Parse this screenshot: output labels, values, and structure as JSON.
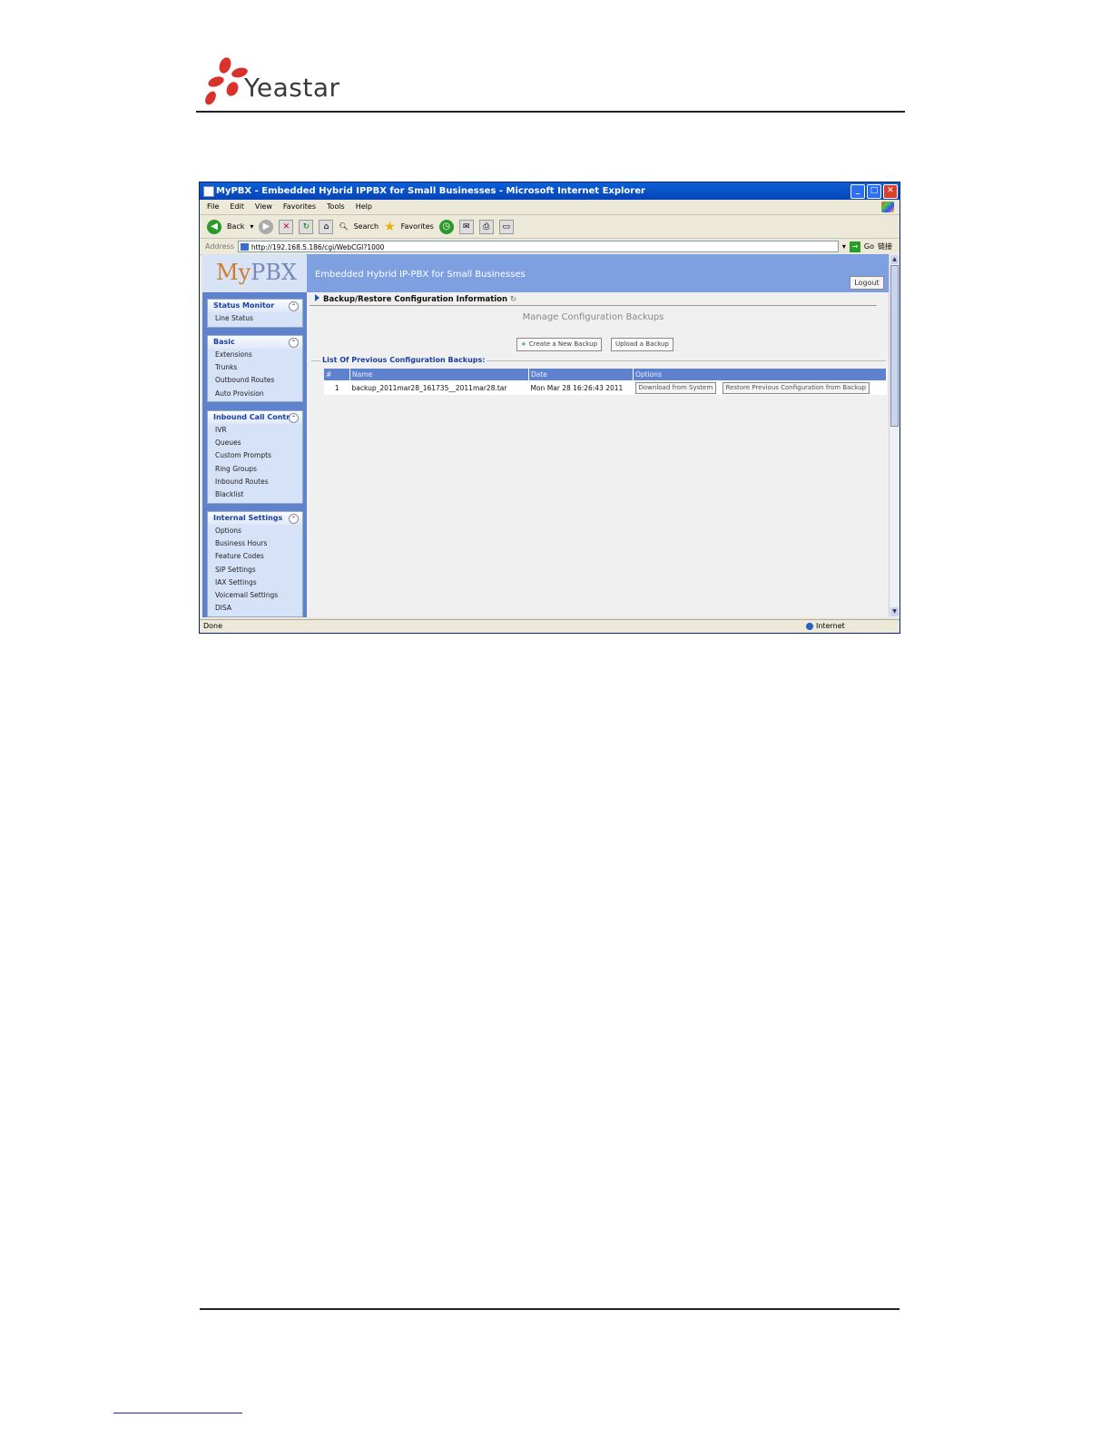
{
  "header": {
    "brand": "Yeastar"
  },
  "window": {
    "title": "MyPBX - Embedded Hybrid IPPBX for Small Businesses - Microsoft Internet Explorer",
    "menu": [
      "File",
      "Edit",
      "View",
      "Favorites",
      "Tools",
      "Help"
    ],
    "toolbar": {
      "back": "Back",
      "search": "Search",
      "favorites": "Favorites"
    },
    "address_label": "Address",
    "address_value": "http://192.168.5.186/cgi/WebCGI?1000",
    "go_label": "Go",
    "links_label": "链接",
    "status_left": "Done",
    "status_zone": "Internet"
  },
  "app": {
    "logo": "MyPBX",
    "logo_my": "My",
    "logo_pbx": "PBX",
    "banner_title": "Embedded Hybrid IP-PBX for Small Businesses",
    "logout": "Logout"
  },
  "sidebar": {
    "groups": [
      {
        "title": "Status Monitor",
        "items": [
          "Line Status"
        ]
      },
      {
        "title": "Basic",
        "items": [
          "Extensions",
          "Trunks",
          "Outbound Routes",
          "Auto Provision"
        ]
      },
      {
        "title": "Inbound Call Control",
        "items": [
          "IVR",
          "Queues",
          "Custom Prompts",
          "Ring Groups",
          "Inbound Routes",
          "Blacklist"
        ]
      },
      {
        "title": "Internal Settings",
        "items": [
          "Options",
          "Business Hours",
          "Feature Codes",
          "SIP Settings",
          "IAX Settings",
          "Voicemail Settings",
          "DISA"
        ]
      }
    ]
  },
  "main": {
    "breadcrumb": "Backup/Restore Configuration Information",
    "section_title": "Manage Configuration Backups",
    "create_button": "Create a New Backup",
    "upload_button": "Upload a Backup",
    "list_title": "List Of Previous Configuration Backups:",
    "columns": [
      "#",
      "Name",
      "Date",
      "Options"
    ],
    "rows": [
      {
        "num": "1",
        "name": "backup_2011mar28_161735__2011mar28.tar",
        "date": "Mon Mar 28 16:26:43 2011",
        "download": "Download from System",
        "restore": "Restore Previous Configuration from Backup"
      }
    ]
  },
  "colors": {
    "banner": "#7ea0e0",
    "sidebar": "#5f82cf",
    "accent": "#1a3fa0",
    "logo_red": "#d9312b"
  }
}
